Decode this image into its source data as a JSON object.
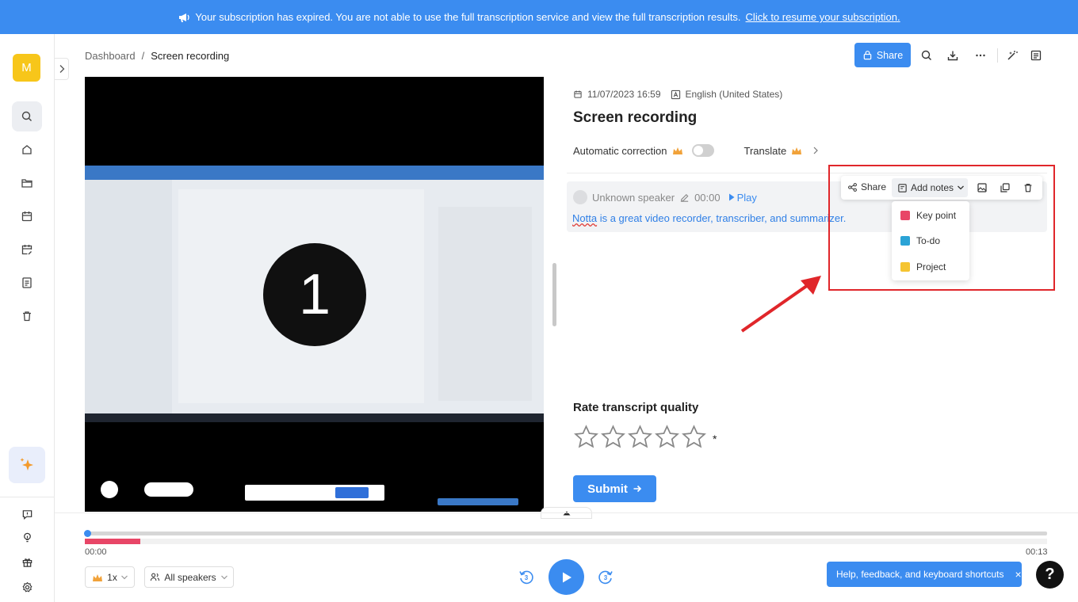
{
  "banner": {
    "icon": "megaphone-icon",
    "message": "Your subscription has expired. You are not able to use the full transcription service and view the full transcription results.",
    "link": "Click to resume your subscription."
  },
  "sidebar": {
    "avatar_letter": "M",
    "items": [
      "search-icon",
      "home-icon",
      "folder-icon",
      "calendar-icon",
      "calendar-edit-icon",
      "document-icon",
      "trash-icon"
    ],
    "bottom_items": [
      "feedback-icon",
      "lightbulb-icon",
      "gift-icon",
      "settings-icon"
    ]
  },
  "breadcrumb": {
    "root": "Dashboard",
    "separator": "/",
    "current": "Screen recording"
  },
  "header": {
    "share_label": "Share"
  },
  "video": {
    "countdown": "1"
  },
  "recording": {
    "datetime": "11/07/2023 16:59",
    "language": "English (United States)",
    "title": "Screen recording",
    "auto_correction_label": "Automatic correction",
    "translate_label": "Translate"
  },
  "segment": {
    "speaker": "Unknown speaker",
    "time": "00:00",
    "play_label": "Play",
    "text_first": "Notta",
    "text_rest": " is a great video recorder, transcriber, and summarizer."
  },
  "toolbar": {
    "share_label": "Share",
    "add_notes_label": "Add notes"
  },
  "notes_menu": [
    {
      "label": "Key point",
      "color": "#e84667"
    },
    {
      "label": "To-do",
      "color": "#2ba3d6"
    },
    {
      "label": "Project",
      "color": "#f5c431"
    }
  ],
  "rating": {
    "title": "Rate transcript quality",
    "required_mark": "*",
    "submit_label": "Submit",
    "stars": 0,
    "max_stars": 5
  },
  "player": {
    "current_time": "00:00",
    "total_time": "00:13",
    "progress": 0,
    "speed": "1x",
    "speakers_label": "All speakers",
    "skip_back_seconds": "3",
    "skip_forward_seconds": "3"
  },
  "help": {
    "label": "Help, feedback, and keyboard shortcuts",
    "close": "×",
    "question": "?"
  },
  "colors": {
    "accent": "#3b8cf0",
    "highlight_box": "#e0262a"
  }
}
